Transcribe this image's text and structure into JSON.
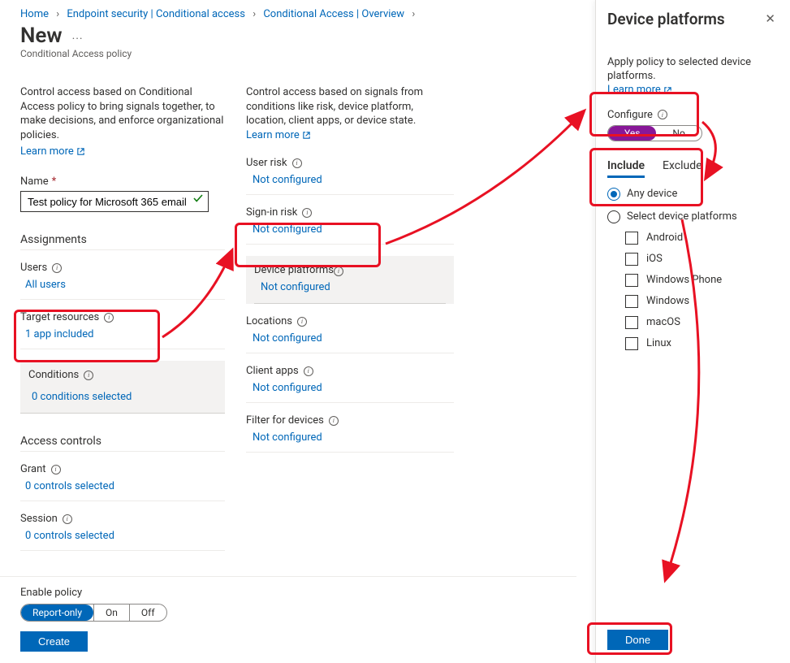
{
  "breadcrumb": {
    "items": [
      "Home",
      "Endpoint security | Conditional access",
      "Conditional Access | Overview"
    ]
  },
  "page": {
    "title": "New",
    "subtitle": "Conditional Access policy"
  },
  "left": {
    "desc": "Control access based on Conditional Access policy to bring signals together, to make decisions, and enforce organizational policies.",
    "learn_more": "Learn more",
    "name_label": "Name",
    "name_value": "Test policy for Microsoft 365 email",
    "assignments_hdr": "Assignments",
    "users_label": "Users",
    "users_value": "All users",
    "target_label": "Target resources",
    "target_value": "1 app included",
    "conditions_label": "Conditions",
    "conditions_value": "0 conditions selected",
    "access_hdr": "Access controls",
    "grant_label": "Grant",
    "grant_value": "0 controls selected",
    "session_label": "Session",
    "session_value": "0 controls selected"
  },
  "right": {
    "desc_prefix": "Control access based on signals from conditions like risk, device platform, location, client apps, or device state. ",
    "learn_more": "Learn more",
    "items": [
      {
        "label": "User risk",
        "value": "Not configured"
      },
      {
        "label": "Sign-in risk",
        "value": "Not configured"
      },
      {
        "label": "Device platforms",
        "value": "Not configured"
      },
      {
        "label": "Locations",
        "value": "Not configured"
      },
      {
        "label": "Client apps",
        "value": "Not configured"
      },
      {
        "label": "Filter for devices",
        "value": "Not configured"
      }
    ]
  },
  "footer": {
    "enable_label": "Enable policy",
    "seg1": "Report-only",
    "seg2": "On",
    "seg3": "Off",
    "create": "Create"
  },
  "panel": {
    "title": "Device platforms",
    "desc": "Apply policy to selected device platforms.",
    "learn_more": "Learn more",
    "configure": "Configure",
    "yes": "Yes",
    "no": "No",
    "tab_include": "Include",
    "tab_exclude": "Exclude",
    "opt_any": "Any device",
    "opt_select": "Select device platforms",
    "platforms": [
      "Android",
      "iOS",
      "Windows Phone",
      "Windows",
      "macOS",
      "Linux"
    ],
    "done": "Done"
  }
}
